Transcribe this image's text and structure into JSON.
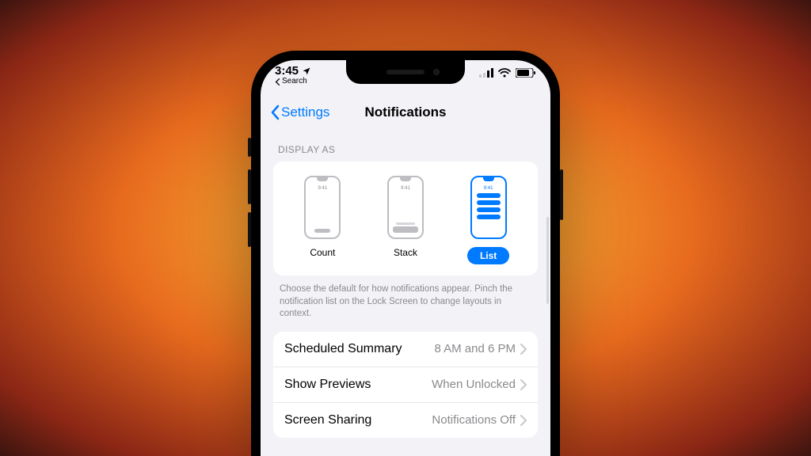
{
  "status": {
    "time": "3:45",
    "back_hint_label": "Search"
  },
  "navbar": {
    "back_label": "Settings",
    "title": "Notifications"
  },
  "display_as": {
    "header": "DISPLAY AS",
    "preview_time": "9:41",
    "options": {
      "count": "Count",
      "stack": "Stack",
      "list": "List"
    },
    "selected": "list",
    "note": "Choose the default for how notifications appear. Pinch the notification list on the Lock Screen to change layouts in context."
  },
  "rows": {
    "scheduled_summary": {
      "label": "Scheduled Summary",
      "value": "8 AM and 6 PM"
    },
    "show_previews": {
      "label": "Show Previews",
      "value": "When Unlocked"
    },
    "screen_sharing": {
      "label": "Screen Sharing",
      "value": "Notifications Off"
    }
  }
}
